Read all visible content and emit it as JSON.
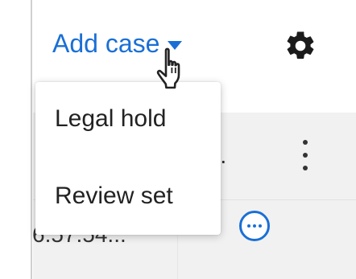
{
  "toolbar": {
    "add_case_label": "Add case",
    "add_case_icon": "caret-down-icon",
    "settings_icon": "gear-icon"
  },
  "dropdown": {
    "items": [
      {
        "label": "Legal hold"
      },
      {
        "label": "Review set"
      }
    ]
  },
  "table": {
    "row1_text": "ct...",
    "row1_menu_icon": "more-vertical-icon",
    "row2_text": "6.57.54...",
    "row2_action_icon": "more-horizontal-circle-icon"
  },
  "colors": {
    "accent": "#1a6fd6",
    "panel_bg": "#f1f1f1"
  }
}
